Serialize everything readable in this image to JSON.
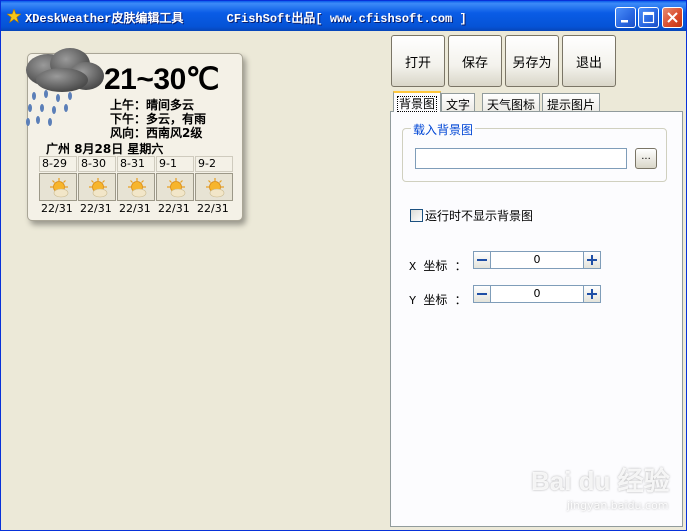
{
  "window": {
    "title": "XDeskWeather皮肤编辑工具      CFishSoft出品[ www.cfishsoft.com ]"
  },
  "preview": {
    "temperature": "21~30℃",
    "morning": "上午：晴间多云",
    "afternoon": "下午：多云，有雨",
    "wind": "风向：西南风2级",
    "city_date": "广州 8月28日 星期六",
    "forecast": [
      {
        "date": "8-29",
        "range": "22/31",
        "icon": "sun-cloud-icon"
      },
      {
        "date": "8-30",
        "range": "22/31",
        "icon": "sun-cloud-icon"
      },
      {
        "date": "8-31",
        "range": "22/31",
        "icon": "sun-cloud-icon"
      },
      {
        "date": "9-1",
        "range": "22/31",
        "icon": "sun-cloud-icon"
      },
      {
        "date": "9-2",
        "range": "22/31",
        "icon": "sun-cloud-icon"
      }
    ]
  },
  "toolbar": {
    "open": "打开",
    "save": "保存",
    "save_as": "另存为",
    "exit": "退出"
  },
  "tabs": [
    "背景图",
    "文字",
    "天气图标",
    "提示图片"
  ],
  "background_tab": {
    "group_title": "载入背景图",
    "path_value": "",
    "browse_label": "...",
    "hide_checkbox_label": "运行时不显示背景图",
    "hide_checked": false,
    "x_label": "X 坐标 ：",
    "x_value": "0",
    "y_label": "Y 坐标 ：",
    "y_value": "0"
  },
  "watermark": {
    "logo": "Bai du 经验",
    "url": "jingyan.baidu.com"
  },
  "colors": {
    "titlebar": "#0A5CE6",
    "window_bg": "#ECE9D8",
    "group_label": "#0046D5",
    "active_tab_accent": "#FFC83C"
  }
}
